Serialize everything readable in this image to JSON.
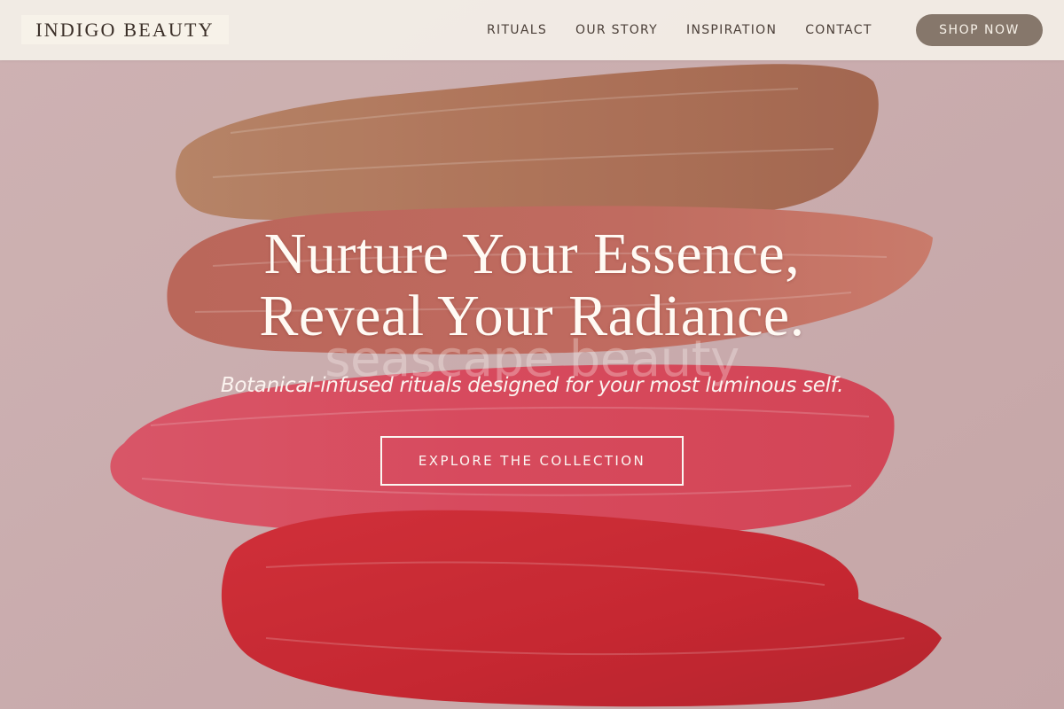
{
  "brand": {
    "logo_text": "INDIGO BEAUTY"
  },
  "nav": {
    "items": [
      {
        "label": "RITUALS"
      },
      {
        "label": "OUR STORY"
      },
      {
        "label": "INSPIRATION"
      },
      {
        "label": "CONTACT"
      }
    ],
    "cta_label": "SHOP NOW"
  },
  "hero": {
    "title_line1": "Nurture Your Essence,",
    "title_line2": "Reveal Your Radiance.",
    "watermark": "seascape beauty",
    "subtitle": "Botanical-infused rituals designed for your most luminous self.",
    "cta_label": "EXPLORE THE COLLECTION",
    "background_image": "lipstick-swatch-strokes"
  },
  "colors": {
    "header_bg": "#f3eee7",
    "shop_button_bg": "#86776b",
    "page_bg": "#c9a9ab",
    "swatch_brown": "#a86a4c",
    "swatch_terracotta": "#bb5a4e",
    "swatch_pink": "#d73a4e",
    "swatch_red": "#c4141f"
  }
}
